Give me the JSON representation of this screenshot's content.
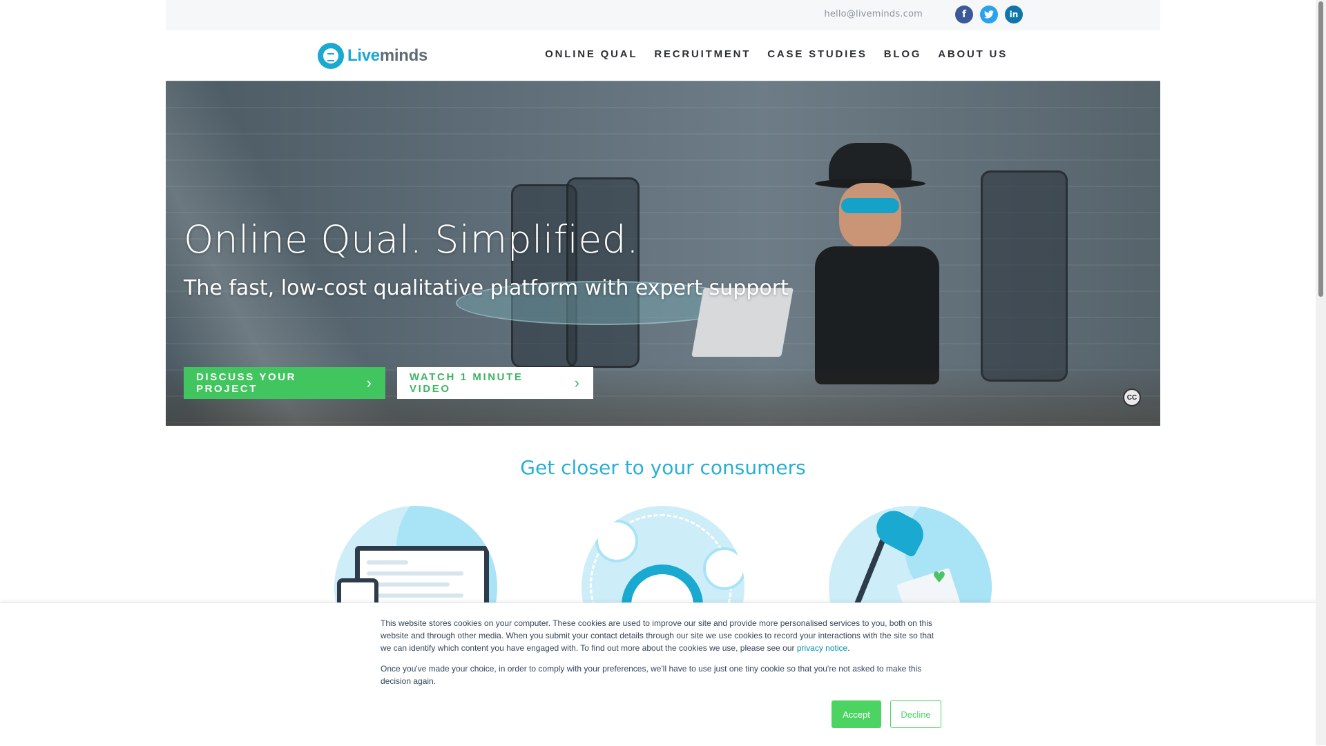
{
  "topbar": {
    "email": "hello@liveminds.com",
    "social": [
      {
        "name": "facebook",
        "glyph": "f"
      },
      {
        "name": "twitter",
        "glyph": "t"
      },
      {
        "name": "linkedin",
        "glyph": "in"
      }
    ]
  },
  "header": {
    "logo_part1": "Live",
    "logo_part2": "minds",
    "nav": [
      "ONLINE QUAL",
      "RECRUITMENT",
      "CASE STUDIES",
      "BLOG",
      "ABOUT US"
    ]
  },
  "hero": {
    "title": "Online Qual. Simplified.",
    "subtitle": "The fast, low-cost qualitative platform with expert support",
    "primary_button": "DISCUSS YOUR PROJECT",
    "secondary_button": "WATCH 1 MINUTE VIDEO",
    "chevron": "›",
    "cc_badge": "CC"
  },
  "section": {
    "title": "Get closer to your consumers"
  },
  "cookie": {
    "paragraph1_before": "This website stores cookies on your computer. These cookies are used to improve our site and provide more personalised services to you, both on this website and through other media. When you submit your contact details through our site we use cookies to record your interactions with the site so that we can identify which content you have engaged with. To find out more about the cookies we use, please see our ",
    "paragraph1_link": "privacy notice",
    "paragraph1_after": ".",
    "paragraph2": "Once you've made your choice, in order to comply with your preferences, we'll have to use just one tiny cookie so that you're not asked to make this decision again.",
    "accept": "Accept",
    "decline": "Decline"
  },
  "colors": {
    "brand_blue": "#1aa9d1",
    "accent_green": "#41c55e",
    "cookie_green": "#4cd463",
    "heading_blue": "#27b0d6"
  }
}
